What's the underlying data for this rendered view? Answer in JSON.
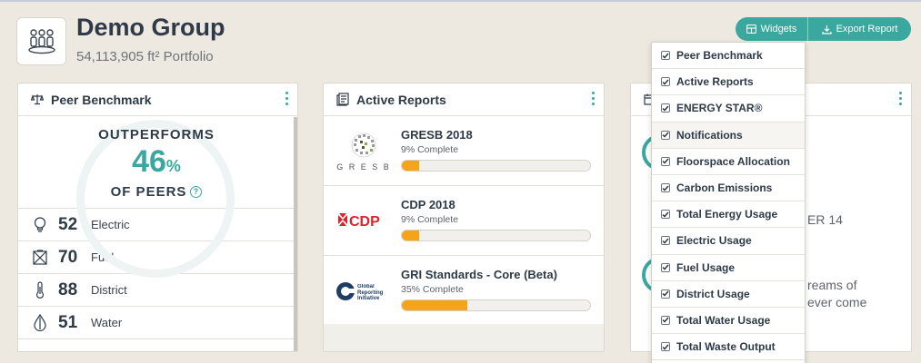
{
  "header": {
    "title": "Demo Group",
    "area": "54,113,905 ft² Portfolio",
    "widgets_label": "Widgets",
    "export_label": "Export Report"
  },
  "benchmark": {
    "title": "Peer Benchmark",
    "outperforms": "OUTPERFORMS",
    "percent": "46",
    "percent_symbol": "%",
    "of_peers": "OF PEERS",
    "rows": [
      {
        "score": "52",
        "label": "Electric",
        "icon": "lightbulb-icon"
      },
      {
        "score": "70",
        "label": "Fuel",
        "icon": "fuel-icon"
      },
      {
        "score": "88",
        "label": "District",
        "icon": "thermometer-icon"
      },
      {
        "score": "51",
        "label": "Water",
        "icon": "water-drop-icon"
      }
    ]
  },
  "reports": {
    "title": "Active Reports",
    "items": [
      {
        "name": "GRESB 2018",
        "status": "9% Complete",
        "progress": 0.09,
        "logo_text": "G R E S B"
      },
      {
        "name": "CDP 2018",
        "status": "9% Complete",
        "progress": 0.09,
        "logo_text": "CDP"
      },
      {
        "name": "GRI Standards - Core (Beta)",
        "status": "35% Complete",
        "progress": 0.35,
        "logo_text": "Global Reporting Initiative"
      }
    ]
  },
  "card3": {
    "text1": "ER 14",
    "text2": "reams of",
    "text3": "ever come"
  },
  "widget_menu": {
    "items": [
      {
        "label": "Peer Benchmark",
        "checked": true
      },
      {
        "label": "Active Reports",
        "checked": true
      },
      {
        "label": "ENERGY STAR®",
        "checked": true
      },
      {
        "label": "Notifications",
        "checked": true
      },
      {
        "label": "Floorspace Allocation",
        "checked": true
      },
      {
        "label": "Carbon Emissions",
        "checked": true
      },
      {
        "label": "Total Energy Usage",
        "checked": true
      },
      {
        "label": "Electric Usage",
        "checked": true
      },
      {
        "label": "Fuel Usage",
        "checked": true
      },
      {
        "label": "District Usage",
        "checked": true
      },
      {
        "label": "Total Water Usage",
        "checked": true
      },
      {
        "label": "Total Waste Output",
        "checked": true
      }
    ]
  },
  "colors": {
    "accent": "#3aa89e",
    "progress": "#f5a41a",
    "background": "#ede9e1"
  }
}
